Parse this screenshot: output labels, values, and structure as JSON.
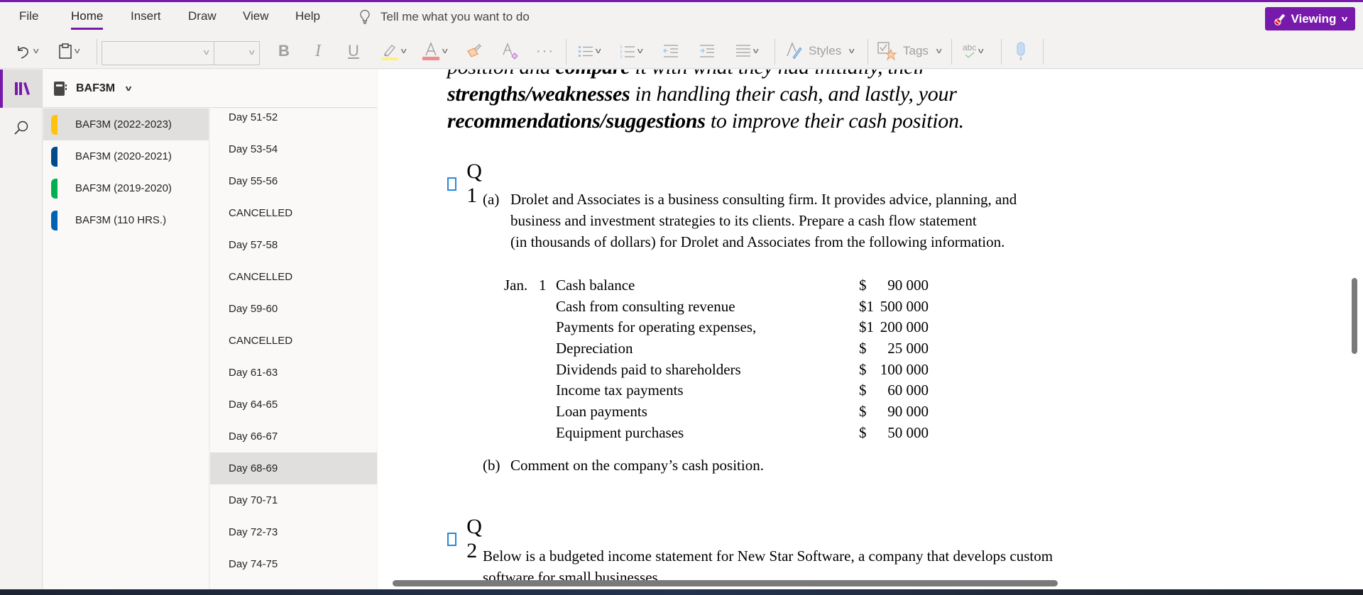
{
  "app": {
    "accent_color": "#7719aa",
    "mode_button": "Viewing"
  },
  "menu": {
    "tabs": [
      "File",
      "Home",
      "Insert",
      "Draw",
      "View",
      "Help"
    ],
    "active_tab": "Home",
    "tell_me_placeholder": "Tell me what you want to do"
  },
  "ribbon": {
    "font_name": "",
    "font_size": "",
    "bold": "B",
    "italic": "I",
    "underline": "U",
    "more": "···",
    "styles_label": "Styles",
    "tags_label": "Tags",
    "spelling_label": "abc",
    "highlight_color": "#fff27a",
    "font_color": "#f28b8b"
  },
  "notebook": {
    "name": "BAF3M"
  },
  "sections": [
    {
      "label": "BAF3M (2022-2023)",
      "color": "#ffc20e",
      "active": true
    },
    {
      "label": "BAF3M (2020-2021)",
      "color": "#004b8c",
      "active": false
    },
    {
      "label": "BAF3M (2019-2020)",
      "color": "#00b050",
      "active": false
    },
    {
      "label": "BAF3M (110 HRS.)",
      "color": "#0063b1",
      "active": false
    }
  ],
  "pages": [
    {
      "label": "Day 51-52"
    },
    {
      "label": "Day 53-54"
    },
    {
      "label": "Day 55-56"
    },
    {
      "label": "CANCELLED"
    },
    {
      "label": "Day 57-58"
    },
    {
      "label": "CANCELLED"
    },
    {
      "label": "Day 59-60"
    },
    {
      "label": "CANCELLED"
    },
    {
      "label": "Day 61-63"
    },
    {
      "label": "Day 64-65"
    },
    {
      "label": "Day 66-67"
    },
    {
      "label": "Day 68-69",
      "active": true
    },
    {
      "label": "Day 70-71"
    },
    {
      "label": "Day 72-73"
    },
    {
      "label": "Day 74-75"
    }
  ],
  "content": {
    "intro": {
      "line1_a": "position and ",
      "line1_b": "compare",
      "line1_c": " it with what they had initially, their",
      "line2_a": "strengths/weaknesses",
      "line2_b": " in handling their cash, and lastly, your",
      "line3_a": "recommendations/suggestions",
      "line3_b": " to improve their cash position."
    },
    "q1": {
      "title": "Q 1",
      "part_a_label": "(a)",
      "part_a_lines": [
        "Drolet and Associates is a business consulting firm. It provides advice, planning, and",
        "business and investment strategies to its clients. Prepare a cash flow statement",
        "(in thousands of dollars) for Drolet and Associates from the following information."
      ],
      "ledger": [
        {
          "prefix": "Jan.   1",
          "desc": "Cash balance",
          "currency": "$",
          "amount": "90 000"
        },
        {
          "prefix": "",
          "desc": "Cash from consulting revenue",
          "currency": "$1",
          "amount": "500 000"
        },
        {
          "prefix": "",
          "desc": "Payments for operating expenses,",
          "currency": "$1",
          "amount": "200 000"
        },
        {
          "prefix": "",
          "desc": "Depreciation",
          "currency": "$",
          "amount": "25 000"
        },
        {
          "prefix": "",
          "desc": "Dividends paid to shareholders",
          "currency": "$",
          "amount": "100 000"
        },
        {
          "prefix": "",
          "desc": "Income tax payments",
          "currency": "$",
          "amount": "60 000"
        },
        {
          "prefix": "",
          "desc": "Loan payments",
          "currency": "$",
          "amount": "90 000"
        },
        {
          "prefix": "",
          "desc": "Equipment purchases",
          "currency": "$",
          "amount": "50 000"
        }
      ],
      "part_b_label": "(b)",
      "part_b_text": "Comment on the company’s cash position."
    },
    "q2": {
      "title": "Q 2",
      "text": "Below is a budgeted income statement for New Star Software, a company that develops custom",
      "text_cut": "software for small businesses."
    }
  }
}
